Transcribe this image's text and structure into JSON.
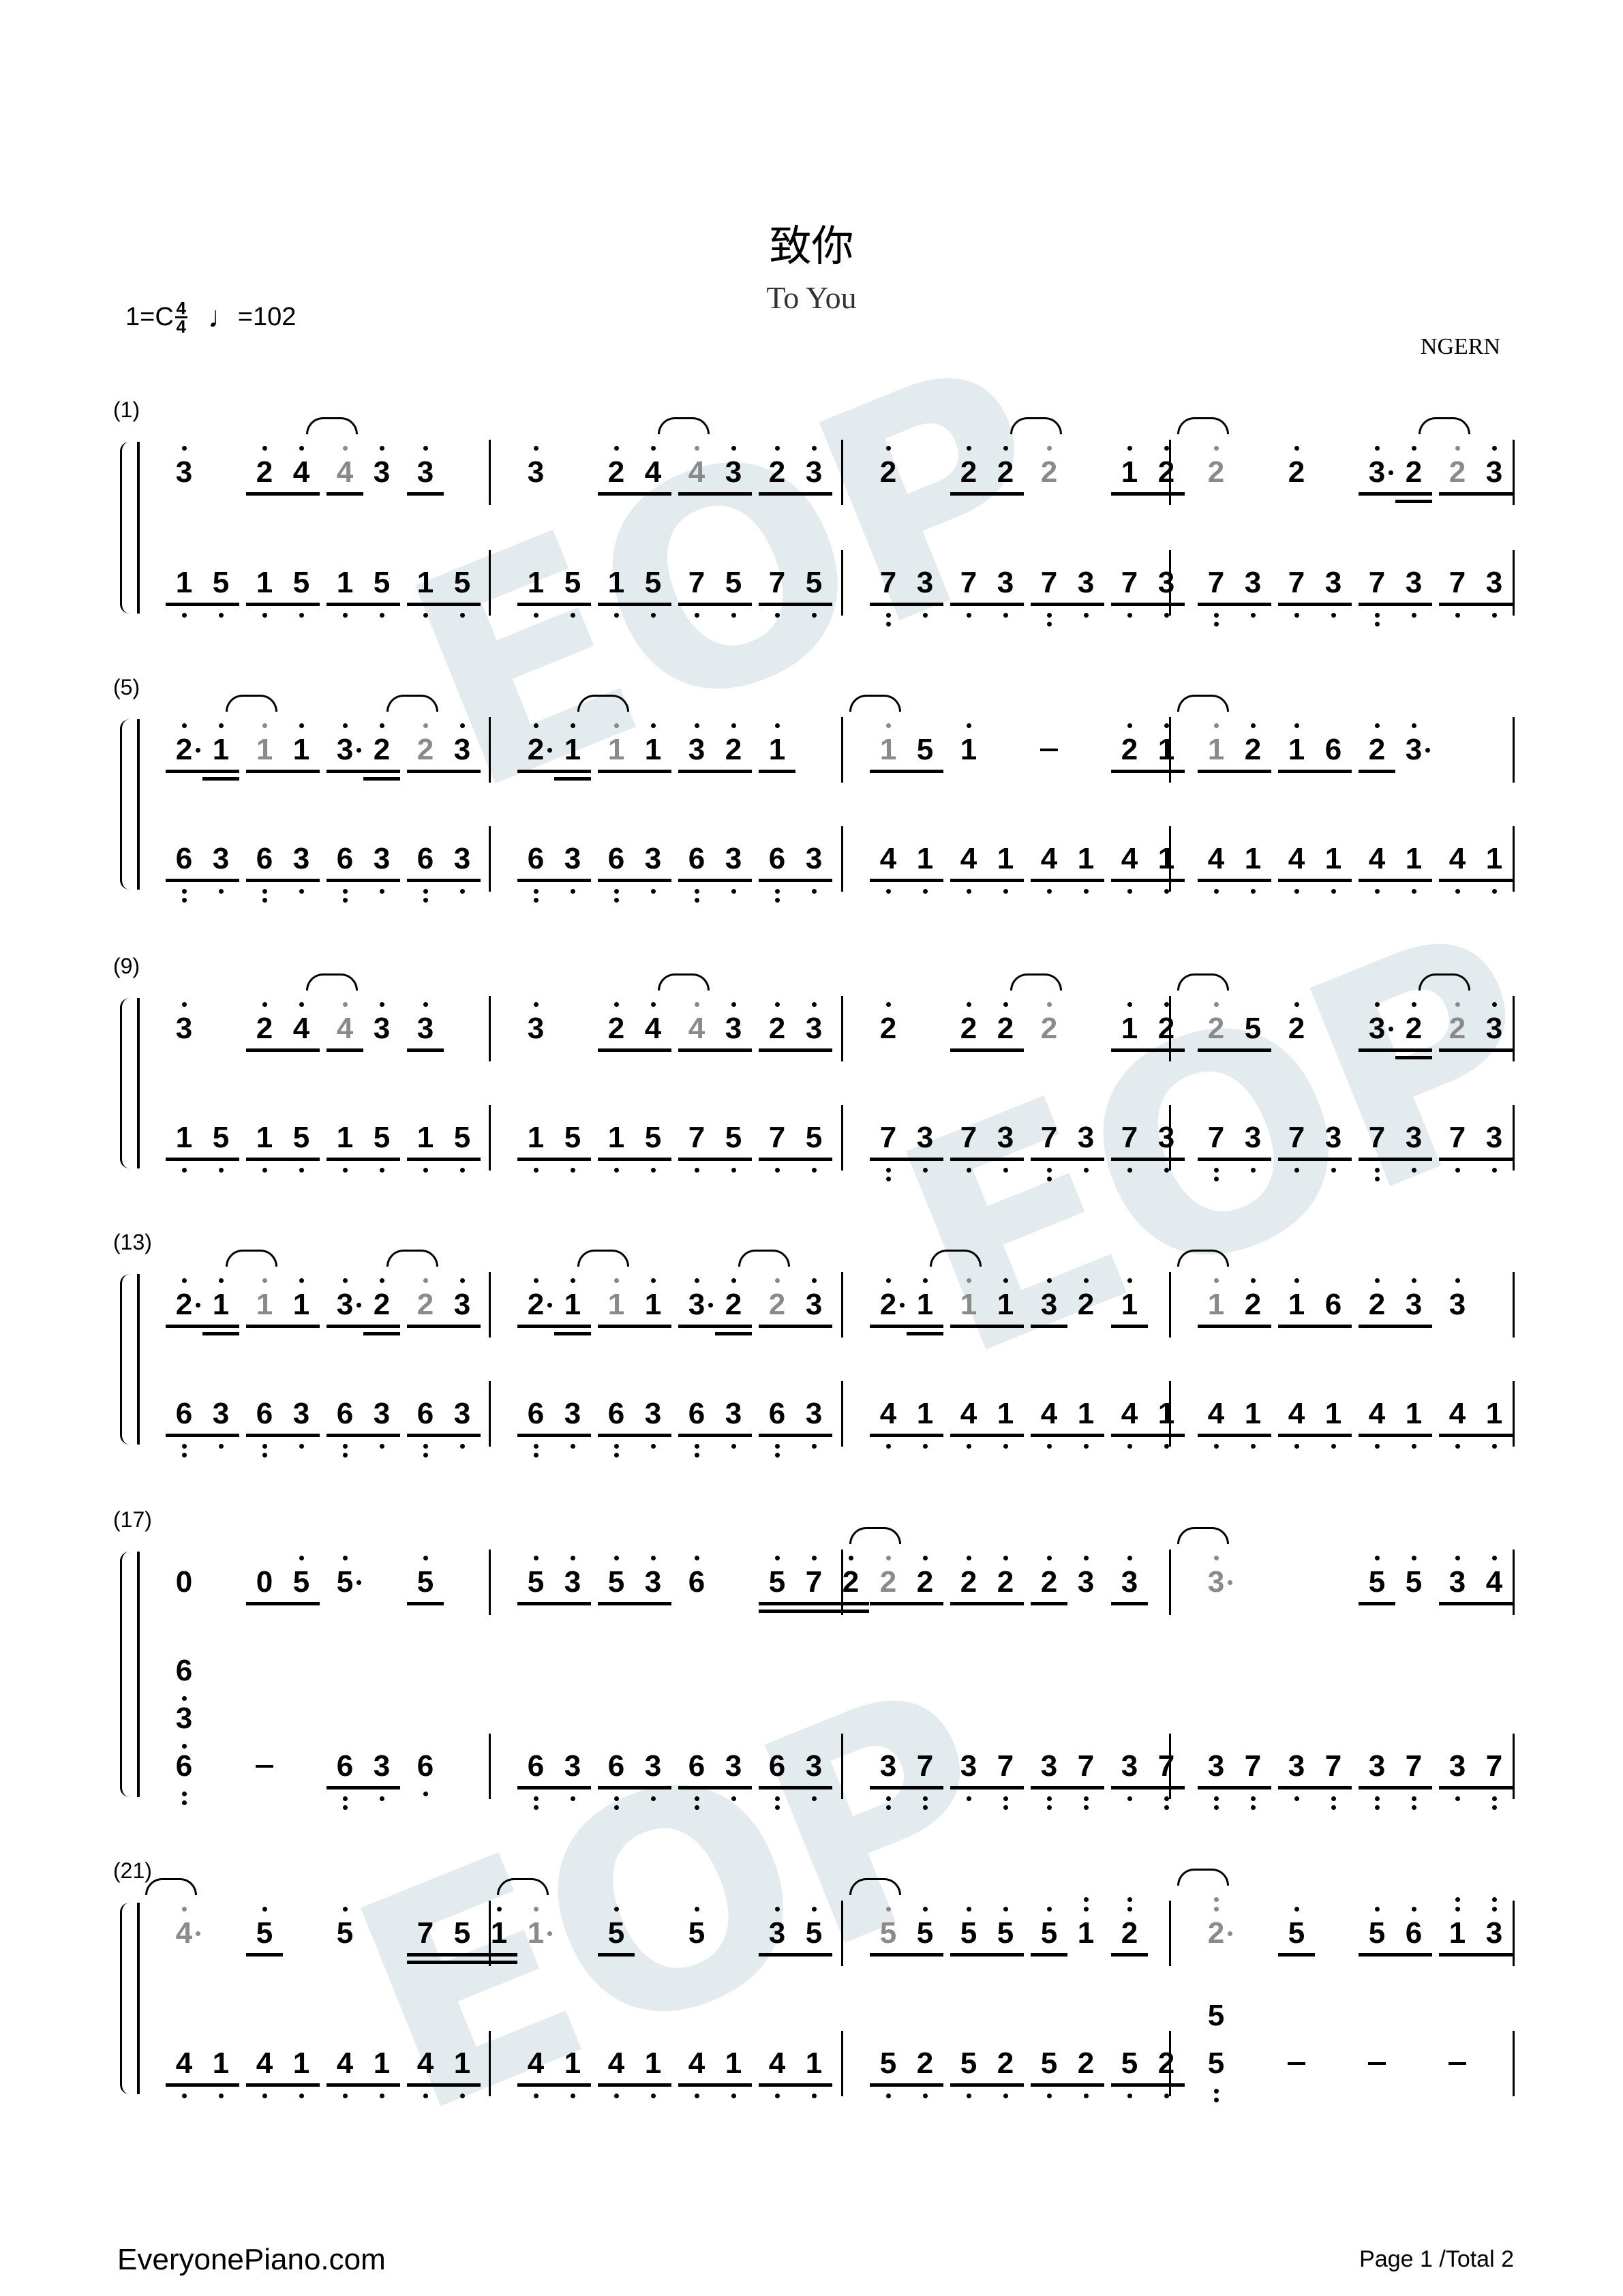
{
  "watermark": "EOP",
  "title": "致你",
  "subtitle": "To You",
  "key": "1=C",
  "time_signature": {
    "top": "4",
    "bottom": "4"
  },
  "tempo": "=102",
  "tempo_icon": "quarter-note-icon",
  "arranger": "NGERN",
  "footer": {
    "site": "EveryonePiano.com",
    "page": "Page 1 /Total 2"
  },
  "notation_key": "digit; ' = high dot; , = low dot; . = augmentation dot; ~ = grey tied note; _ = eighth underline; = = sixteenth underline; | = chord stack (bottom first); - = extension dash",
  "systems": [
    {
      "number": "(1)",
      "treble": [
        [
          "3'",
          "2'_ 4'_",
          "4'~_ 3'",
          "3'_"
        ],
        [
          "3'",
          "2'_ 4'_",
          "4'~_ 3'_",
          "2'_ 3'_"
        ],
        [
          "2'",
          "2'_ 2'_",
          "2'~",
          "1'_ 2'_"
        ],
        [
          "2'~",
          "2'",
          "3'._ 2'=",
          "2'~_ 3'_"
        ]
      ],
      "bass": [
        [
          "1,_ 5,_",
          "1,_ 5,_",
          "1,_ 5,_",
          "1,_ 5,_"
        ],
        [
          "1,_ 5,_",
          "1,_ 5,_",
          "7,_ 5,_",
          "7,_ 5,_"
        ],
        [
          "7,,_ 3,_",
          "7,_ 3,_",
          "7,,_ 3,_",
          "7,_ 3,_"
        ],
        [
          "7,,_ 3,_",
          "7,_ 3,_",
          "7,,_ 3,_",
          "7,_ 3,_"
        ]
      ]
    },
    {
      "number": "(5)",
      "treble": [
        [
          "2'._ 1'=",
          "1'~_ 1'_",
          "3'._ 2'=",
          "2'~_ 3'_"
        ],
        [
          "2'._ 1'=",
          "1'~_ 1'_",
          "3'_ 2'_",
          "1'_"
        ],
        [
          "1'~_ 5_",
          "1'",
          "-",
          "2'_ 1'_"
        ],
        [
          "1'~_ 2'_",
          "1'_ 6_",
          "2'_ 3'.",
          ""
        ]
      ],
      "bass": [
        [
          "6,,_ 3,_",
          "6,,_ 3,_",
          "6,,_ 3,_",
          "6,,_ 3,_"
        ],
        [
          "6,,_ 3,_",
          "6,,_ 3,_",
          "6,,_ 3,_",
          "6,,_ 3,_"
        ],
        [
          "4,_ 1,_",
          "4,_ 1,_",
          "4,_ 1,_",
          "4,_ 1,_"
        ],
        [
          "4,_ 1,_",
          "4,_ 1,_",
          "4,_ 1,_",
          "4,_ 1,_"
        ]
      ]
    },
    {
      "number": "(9)",
      "treble": [
        [
          "3'",
          "2'_ 4'_",
          "4'~_ 3'",
          "3'_"
        ],
        [
          "3'",
          "2'_ 4'_",
          "4'~_ 3'_",
          "2'_ 3'_"
        ],
        [
          "2'",
          "2'_ 2'_",
          "2'~",
          "1'_ 2'_"
        ],
        [
          "2'~_ 5_",
          "2'",
          "3'._ 2'=",
          "2'~_ 3'_"
        ]
      ],
      "bass": [
        [
          "1,_ 5,_",
          "1,_ 5,_",
          "1,_ 5,_",
          "1,_ 5,_"
        ],
        [
          "1,_ 5,_",
          "1,_ 5,_",
          "7,_ 5,_",
          "7,_ 5,_"
        ],
        [
          "7,,_ 3,_",
          "7,_ 3,_",
          "7,,_ 3,_",
          "7,_ 3,_"
        ],
        [
          "7,,_ 3,_",
          "7,_ 3,_",
          "7,,_ 3,_",
          "7,_ 3,_"
        ]
      ]
    },
    {
      "number": "(13)",
      "treble": [
        [
          "2'._ 1'=",
          "1'~_ 1'_",
          "3'._ 2'=",
          "2'~_ 3'_"
        ],
        [
          "2'._ 1'=",
          "1'~_ 1'_",
          "3'._ 2'=",
          "2'~_ 3'_"
        ],
        [
          "2'._ 1'=",
          "1'~_ 1'_",
          "3'_ 2'",
          "1'_"
        ],
        [
          "1'~_ 2'_",
          "1'_ 6_",
          "2'_ 3'_",
          "3'"
        ]
      ],
      "bass": [
        [
          "6,,_ 3,_",
          "6,,_ 3,_",
          "6,,_ 3,_",
          "6,,_ 3,_"
        ],
        [
          "6,,_ 3,_",
          "6,,_ 3,_",
          "6,,_ 3,_",
          "6,,_ 3,_"
        ],
        [
          "4,_ 1,_",
          "4,_ 1,_",
          "4,_ 1,_",
          "4,_ 1,_"
        ],
        [
          "4,_ 1,_",
          "4,_ 1,_",
          "4,_ 1,_",
          "4,_ 1,_"
        ]
      ]
    },
    {
      "number": "(17)",
      "treble": [
        [
          "0",
          "0_ 5'_",
          "5'.",
          "5'_"
        ],
        [
          "5'_ 3'_",
          "5'_ 3'_",
          "6'",
          "5'= 7'= 2'="
        ],
        [
          "2'~_ 2'_",
          "2'_ 2'_",
          "2'_ 3'",
          "3'_"
        ],
        [
          "3'.~",
          "",
          "5'_ 5'",
          "3'_ 4'_"
        ]
      ],
      "bass": [
        [
          "6,,|3,|6,",
          "-",
          "6,,_ 3,_",
          "6,"
        ],
        [
          "6,,_ 3,_",
          "6,,_ 3,_",
          "6,,_ 3,_",
          "6,,_ 3,_"
        ],
        [
          "3,,_ 7,,_",
          "3,_ 7,,_",
          "3,,_ 7,,_",
          "3,_ 7,,_"
        ],
        [
          "3,,_ 7,,_",
          "3,_ 7,,_",
          "3,,_ 7,,_",
          "3,_ 7,,_"
        ]
      ]
    },
    {
      "number": "(21)",
      "treble": [
        [
          "4'.~",
          "5'_",
          "5'",
          "7= 5= 1'="
        ],
        [
          "1'.~",
          "5'_",
          "5'",
          "3'_ 5'_"
        ],
        [
          "5'~_ 5'_",
          "5'_ 5'_",
          "5'_ 1''",
          "2''_"
        ],
        [
          "2''.~",
          "5'_",
          "5'_ 6'_",
          "1''_ 3''_"
        ]
      ],
      "bass": [
        [
          "4,_ 1,_",
          "4,_ 1,_",
          "4,_ 1,_",
          "4,_ 1,_"
        ],
        [
          "4,_ 1,_",
          "4,_ 1,_",
          "4,_ 1,_",
          "4,_ 1,_"
        ],
        [
          "5,_ 2,_",
          "5,_ 2,_",
          "5,_ 2,_",
          "5,_ 2,_"
        ],
        [
          "5,,|5",
          "-",
          "-",
          "-"
        ]
      ]
    }
  ]
}
